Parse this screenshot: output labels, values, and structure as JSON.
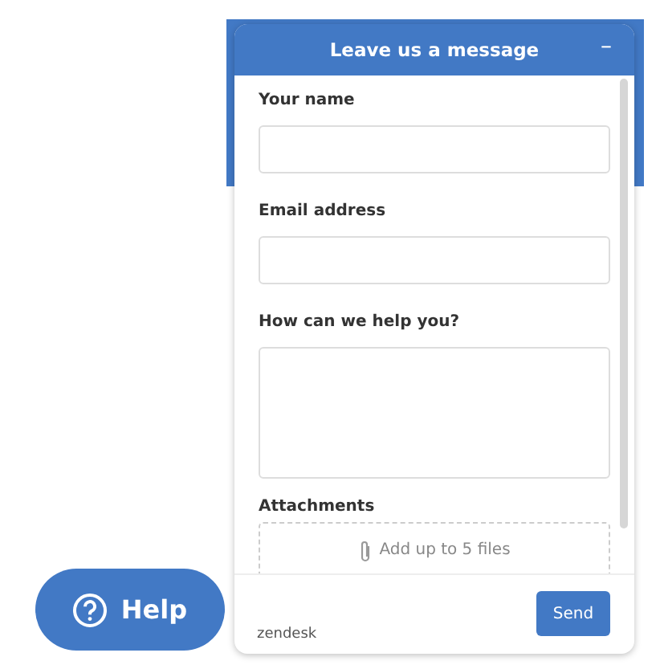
{
  "help_button": {
    "label": "Help"
  },
  "widget": {
    "title": "Leave us a message",
    "minimize": "–",
    "fields": [
      {
        "kind": "input",
        "label": "Your name"
      },
      {
        "kind": "input",
        "label": "Email address"
      },
      {
        "kind": "textarea",
        "label": "How can we help you?"
      },
      {
        "kind": "attachments",
        "label": "Attachments",
        "placeholder": "Add up to 5 files"
      }
    ],
    "brand": "zendesk",
    "send_button": "Send"
  }
}
